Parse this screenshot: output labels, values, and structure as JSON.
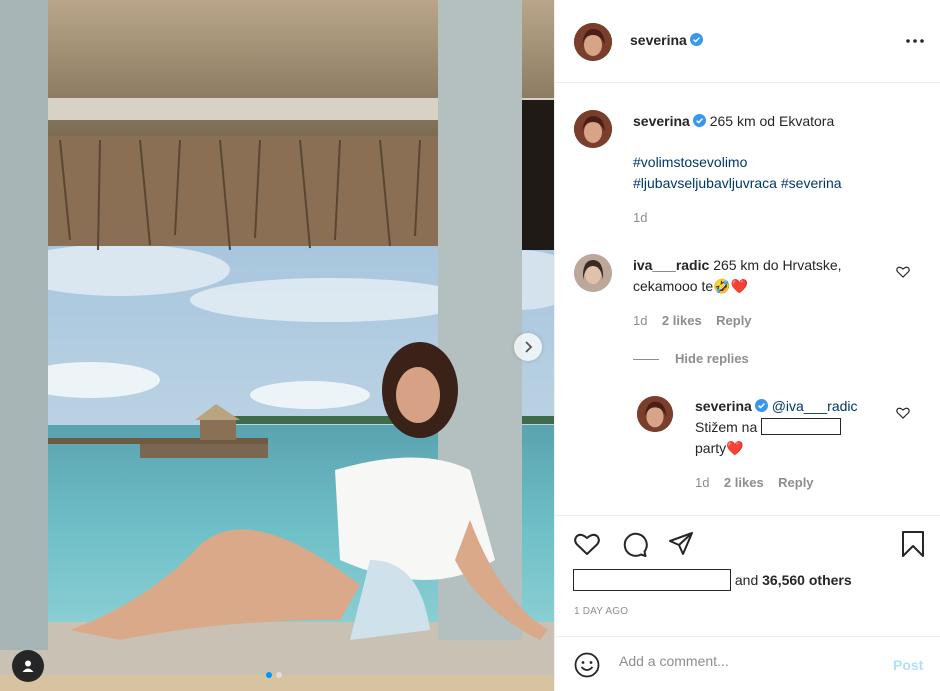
{
  "post": {
    "username": "severina",
    "verified": true
  },
  "caption": {
    "username": "severina",
    "text": "265 km od Ekvatora",
    "hashtags_line1": "#volimstosevolimo",
    "hashtags_line2a": "#ljubavseljubavljuvraca",
    "hashtags_line2b": "#severina",
    "age": "1d"
  },
  "comments": [
    {
      "username": "iva___radic",
      "text_line1": "265 km do Hrvatske,",
      "text_line2": "cekamooo te",
      "emoji": "🤣❤️",
      "age": "1d",
      "likes": "2 likes",
      "reply_label": "Reply",
      "hide_replies_label": "Hide replies"
    }
  ],
  "reply": {
    "username": "severina",
    "mention": "@iva___radic",
    "text_before": "Stižem na",
    "text_after": "party",
    "emoji": "❤️",
    "age": "1d",
    "likes": "2 likes",
    "reply_label": "Reply"
  },
  "likes_summary": {
    "and_label": "and",
    "count": "36,560 others"
  },
  "timestamp": "1 DAY AGO",
  "comment_box": {
    "placeholder": "Add a comment...",
    "post_label": "Post"
  },
  "icons": {
    "more": "more-horizontal-icon",
    "like": "heart-icon",
    "comment": "comment-icon",
    "share": "paper-plane-icon",
    "save": "bookmark-icon",
    "emoji": "smiley-icon",
    "next": "chevron-right-icon",
    "tagged": "user-tag-icon"
  },
  "colors": {
    "verified": "#3897f0",
    "hashtag": "#00376b",
    "heart": "#ed4956",
    "post_disabled": "#b2dffc"
  }
}
